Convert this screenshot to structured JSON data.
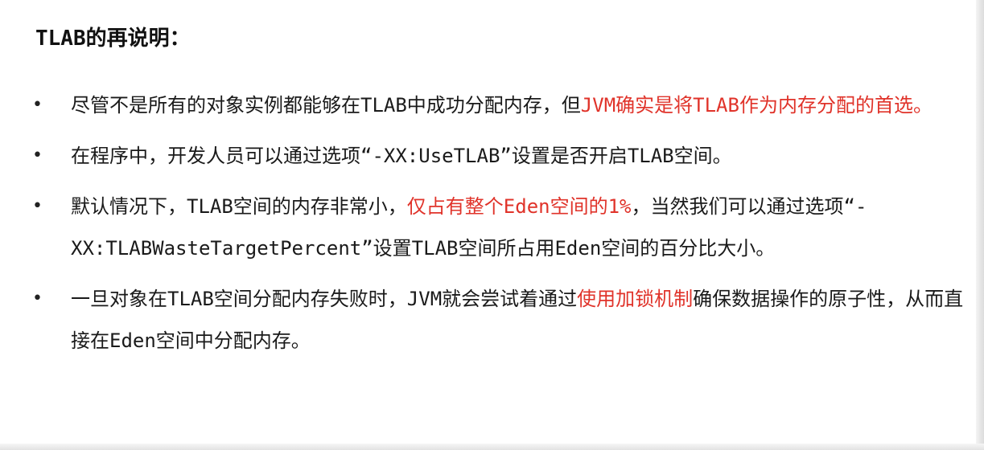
{
  "title": "TLAB的再说明：",
  "bullet_symbol": "•",
  "accent_color": "#e0332a",
  "bullets": [
    {
      "text_a": "尽管不是所有的对象实例都能够在TLAB中成功分配内存，但",
      "highlight": "JVM确实是将TLAB作为内存分配的首选。",
      "text_b": ""
    },
    {
      "text_a": "在程序中，开发人员可以通过选项“-XX:UseTLAB”设置是否开启TLAB空间。",
      "highlight": "",
      "text_b": ""
    },
    {
      "text_a": "默认情况下，TLAB空间的内存非常小，",
      "highlight": "仅占有整个Eden空间的1%",
      "text_b": "，当然我们可以通过选项“-XX:TLABWasteTargetPercent”设置TLAB空间所占用Eden空间的百分比大小。"
    },
    {
      "text_a": "一旦对象在TLAB空间分配内存失败时，JVM就会尝试着通过",
      "highlight": "使用加锁机制",
      "text_b": "确保数据操作的原子性，从而直接在Eden空间中分配内存。"
    }
  ]
}
